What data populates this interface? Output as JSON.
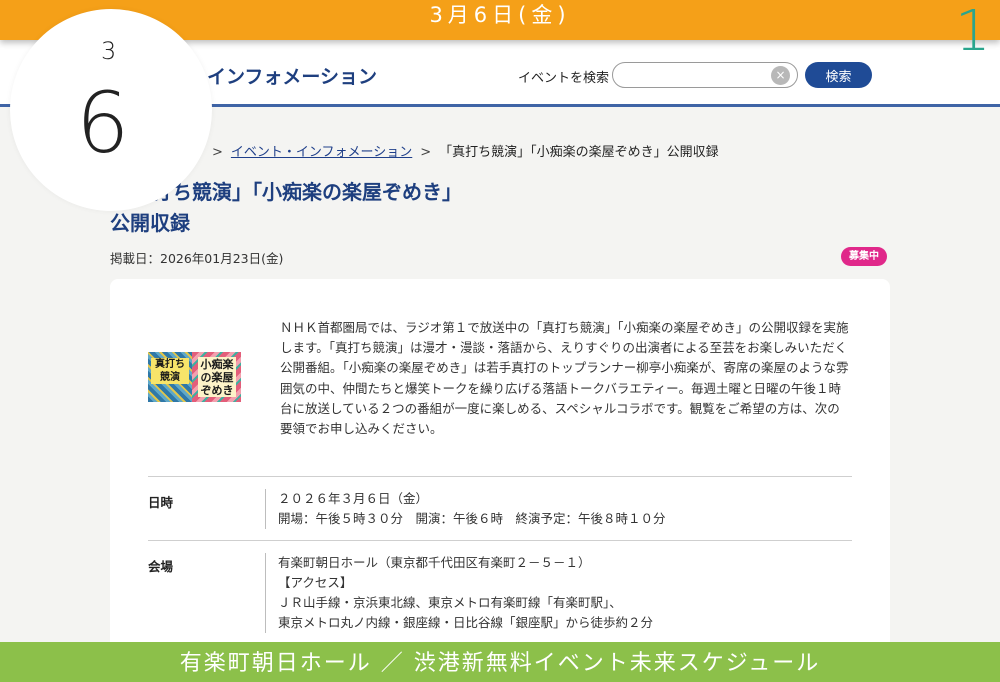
{
  "top_band": {
    "date": "3月6日(金)"
  },
  "day_index": "1",
  "date_circle": {
    "month": "3",
    "day": "6"
  },
  "header": {
    "title": "・インフォメーション",
    "search_label": "イベントを検索",
    "search_value": "",
    "search_placeholder": "",
    "clear_icon": "×",
    "search_button": "検索",
    "accent_color": "#1f4b96"
  },
  "breadcrumb": {
    "sep1": ">",
    "link": "イベント・インフォメーション",
    "sep2": ">",
    "current": "「真打ち競演」「小痴楽の楽屋ぞめき」公開収録"
  },
  "page": {
    "title_line1": "打ち競演」「小痴楽の楽屋ぞめき」",
    "title_line2": "公開収録",
    "posted": "掲載日：2026年01月23日(金)",
    "badge": "募集中",
    "badge_color": "#e0288a"
  },
  "logo": {
    "left_text": "真打ち競演",
    "right_text": "小痴楽の楽屋ぞめき"
  },
  "description": [
    "ＮＨＫ首都圏局では、ラジオ第１で放送中の「真打ち競演」「小痴楽の楽屋ぞめき」の公開収録を実施",
    "します。「真打ち競演」は漫才・漫談・落語から、えりすぐりの出演者による至芸をお楽しみいただく",
    "公開番組。「小痴楽の楽屋ぞめき」は若手真打のトップランナー柳亭小痴楽が、寄席の楽屋のような雰",
    "囲気の中、仲間たちと爆笑トークを繰り広げる落語トークバラエティー。毎週土曜と日曜の午後１時",
    "台に放送している２つの番組が一度に楽しめる、スペシャルコラボです。観覧をご希望の方は、次の",
    "要領でお申し込みください。"
  ],
  "details": {
    "datetime_label": "日時",
    "datetime_line1": "２０２６年３月６日（金）",
    "datetime_line2": "開場：午後５時３０分　開演：午後６時　終演予定：午後８時１０分",
    "venue_label": "会場",
    "venue_line1": "有楽町朝日ホール（東京都千代田区有楽町２－５－１）",
    "venue_line2": "【アクセス】",
    "venue_line3": "ＪＲ山手線・京浜東北線、東京メトロ有楽町線「有楽町駅」、",
    "venue_line4": "東京メトロ丸ノ内線・銀座線・日比谷線「銀座駅」から徒歩約２分"
  },
  "bottom_band": {
    "caption": "有楽町朝日ホール ／ 渋港新無料イベント未来スケジュール"
  },
  "colors": {
    "top_band": "#f5a018",
    "bottom_band": "#8cc04a",
    "day_index": "#2aa58e",
    "title": "#1e3f7f"
  }
}
